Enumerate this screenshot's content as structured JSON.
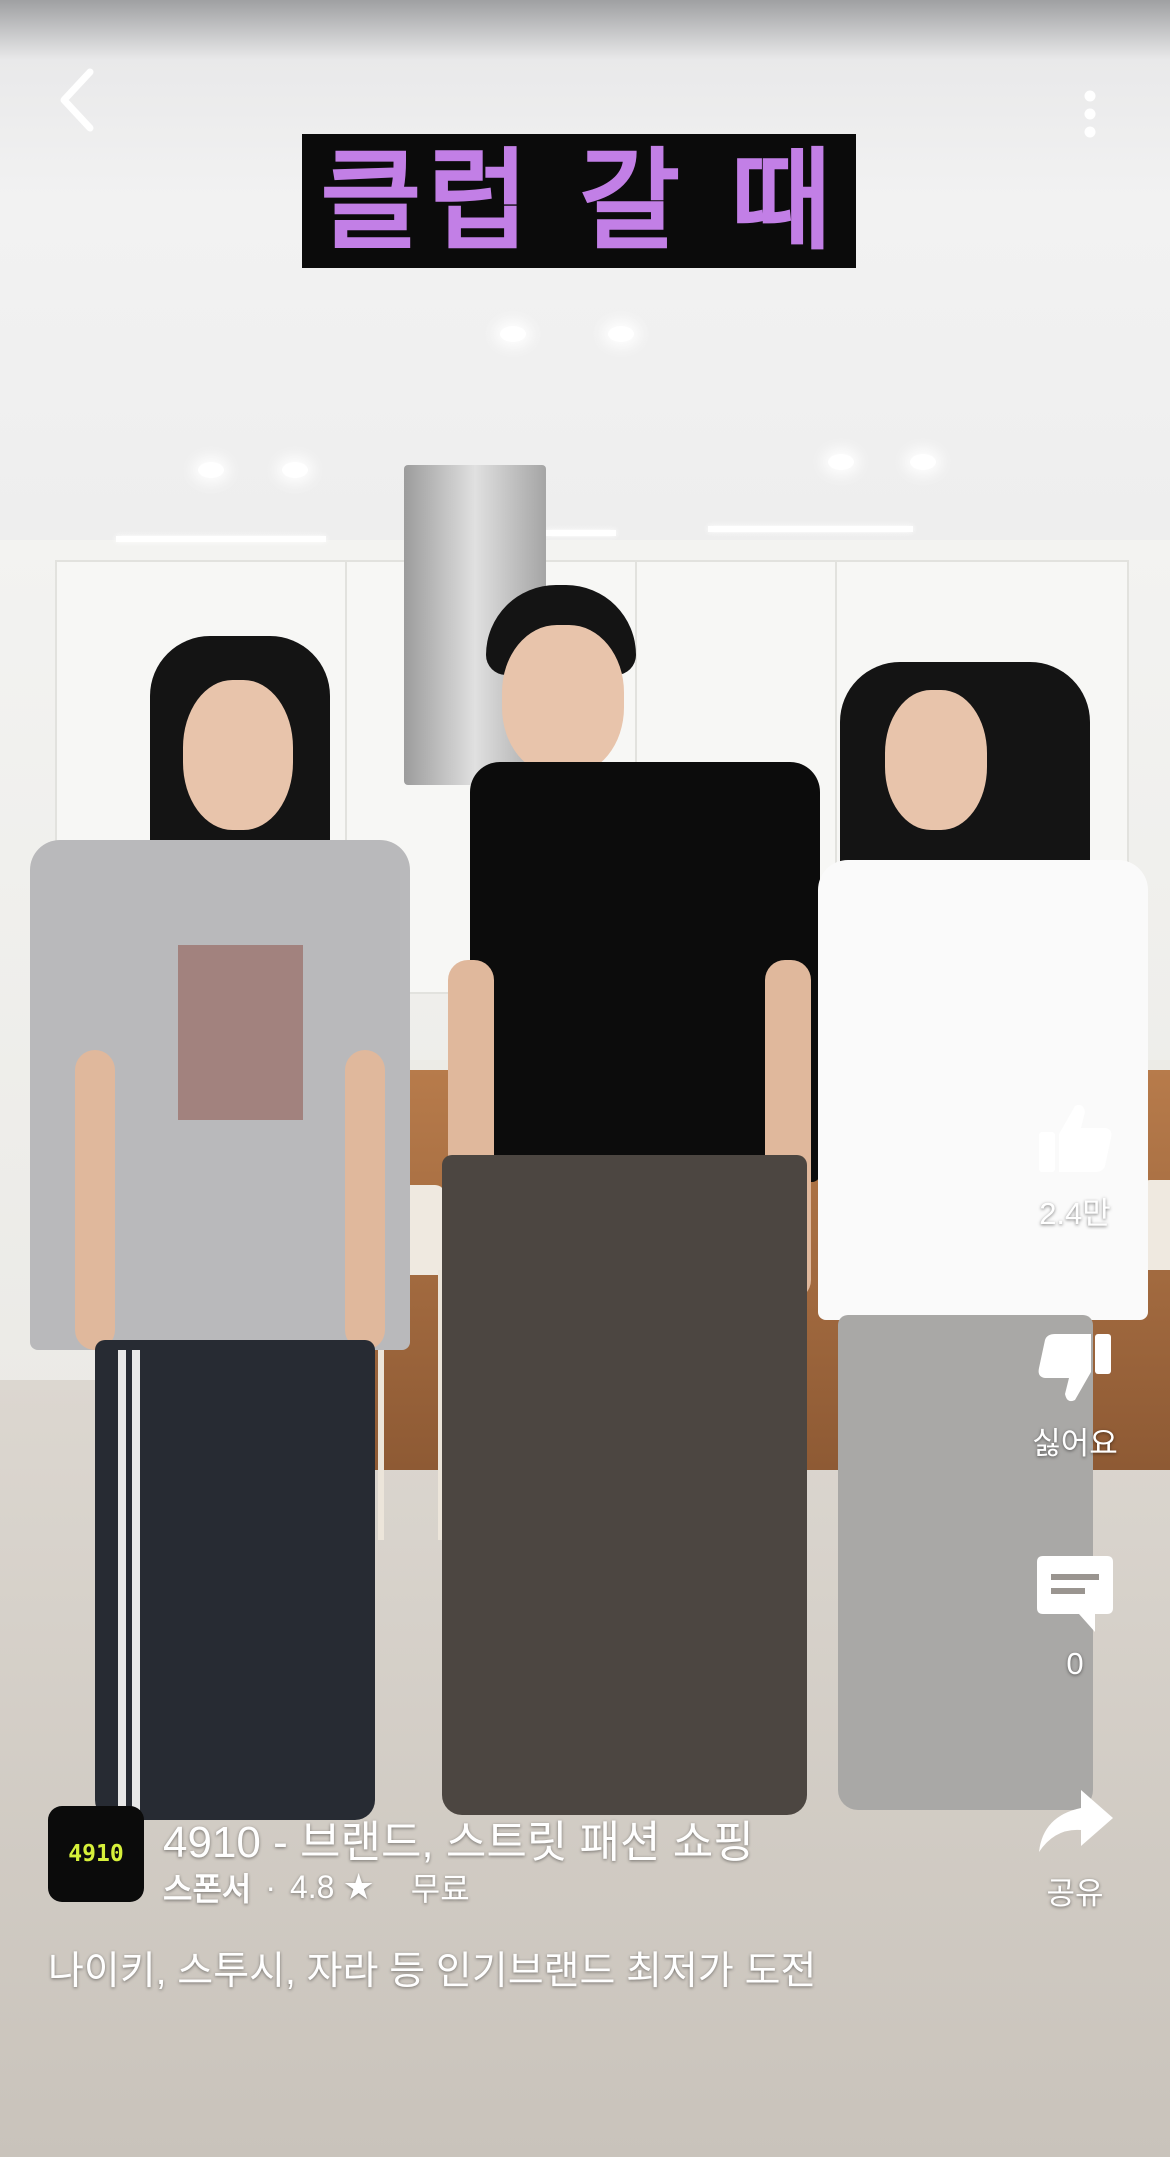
{
  "top_bar": {
    "back_icon": "chevron-left-icon",
    "more_icon": "more-vertical-icon"
  },
  "video": {
    "caption": "클럽 갈 때",
    "caption_color": "#c27fe6"
  },
  "actions": {
    "like": {
      "icon": "thumbs-up-icon",
      "label": "2.4만"
    },
    "dislike": {
      "icon": "thumbs-down-icon",
      "label": "싫어요"
    },
    "comments": {
      "icon": "comment-icon",
      "label": "0"
    },
    "share": {
      "icon": "share-icon",
      "label": "공유"
    }
  },
  "ad": {
    "logo_text": "4910",
    "logo_text_color": "#d6f03a",
    "title": "4910 - 브랜드, 스트릿 패션 쇼핑",
    "sponsor_label": "스폰서",
    "separator": "·",
    "rating": "4.8",
    "star": "★",
    "price": "무료",
    "description": "나이키, 스투시, 자라 등 인기브랜드 최저가 도전"
  }
}
